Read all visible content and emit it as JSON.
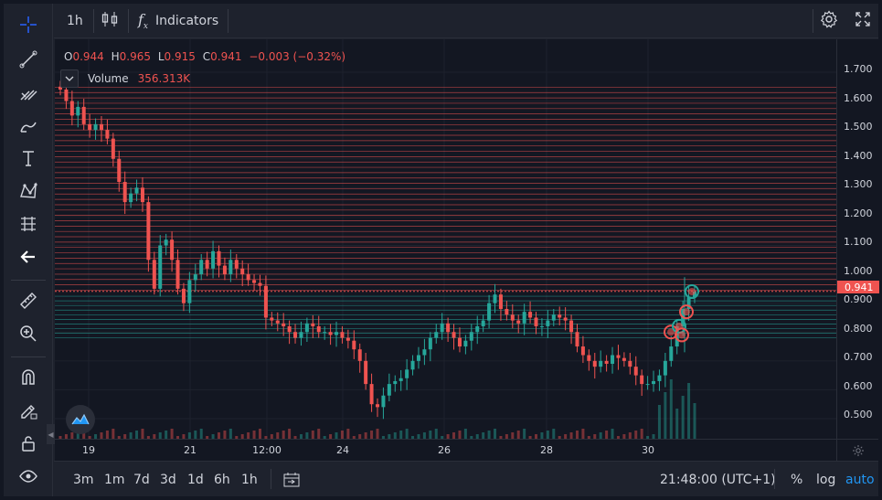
{
  "toolbar": {
    "interval": "1h",
    "indicators_label": "Indicators",
    "icons": [
      "candles-icon",
      "function-icon",
      "gear-icon",
      "fullscreen-icon"
    ]
  },
  "left_tools": [
    "crosshair-icon",
    "trend-line-icon",
    "pitchfork-icon",
    "brush-icon",
    "text-icon",
    "pattern-icon",
    "prediction-icon",
    "back-arrow-icon",
    "ruler-icon",
    "zoom-in-icon",
    "magnet-icon",
    "lock-draw-icon",
    "unlock-icon",
    "eye-icon"
  ],
  "legend": {
    "o_key": "O",
    "o_val": "0.944",
    "h_key": "H",
    "h_val": "0.965",
    "l_key": "L",
    "l_val": "0.915",
    "c_key": "C",
    "c_val": "0.941",
    "change": "−0.003 (−0.32%)",
    "volume_label": "Volume",
    "volume_value": "356.313K"
  },
  "price_scale": {
    "labels": [
      "1.700",
      "1.600",
      "1.500",
      "1.400",
      "1.300",
      "1.200",
      "1.100",
      "1.000",
      "0.900",
      "0.800",
      "0.700",
      "0.600",
      "0.500"
    ],
    "last_price": "0.941"
  },
  "time_scale": {
    "labels": [
      "19",
      "21",
      "12:00",
      "24",
      "26",
      "28",
      "30"
    ]
  },
  "bottom": {
    "ranges": [
      "3m",
      "1m",
      "7d",
      "3d",
      "1d",
      "6h",
      "1h"
    ],
    "clock": "21:48:00 (UTC+1)",
    "percent": "%",
    "log": "log",
    "auto": "auto"
  },
  "colors": {
    "up": "#26a69a",
    "down": "#ef5350",
    "accent": "#2962ff",
    "auto": "#2196f3"
  },
  "chart_data": {
    "type": "candlestick",
    "ylim": [
      0.42,
      1.74
    ],
    "closes": [
      1.64,
      1.6,
      1.55,
      1.58,
      1.52,
      1.5,
      1.52,
      1.5,
      1.47,
      1.4,
      1.32,
      1.25,
      1.28,
      1.3,
      1.25,
      1.05,
      0.95,
      1.1,
      1.12,
      1.05,
      0.95,
      0.9,
      0.98,
      1.0,
      1.05,
      1.02,
      1.08,
      1.03,
      1.0,
      1.05,
      1.02,
      1.0,
      0.98,
      0.97,
      0.96,
      0.85,
      0.84,
      0.83,
      0.82,
      0.8,
      0.78,
      0.8,
      0.83,
      0.82,
      0.8,
      0.8,
      0.79,
      0.8,
      0.78,
      0.77,
      0.74,
      0.7,
      0.62,
      0.55,
      0.54,
      0.58,
      0.62,
      0.63,
      0.64,
      0.67,
      0.7,
      0.72,
      0.74,
      0.78,
      0.8,
      0.83,
      0.8,
      0.78,
      0.75,
      0.77,
      0.8,
      0.82,
      0.84,
      0.9,
      0.93,
      0.88,
      0.86,
      0.84,
      0.83,
      0.87,
      0.85,
      0.82,
      0.82,
      0.84,
      0.86,
      0.85,
      0.84,
      0.8,
      0.75,
      0.72,
      0.7,
      0.68,
      0.7,
      0.69,
      0.72,
      0.71,
      0.7,
      0.68,
      0.65,
      0.62,
      0.62,
      0.63,
      0.65,
      0.7,
      0.75,
      0.82,
      0.88,
      0.92,
      0.94
    ]
  }
}
